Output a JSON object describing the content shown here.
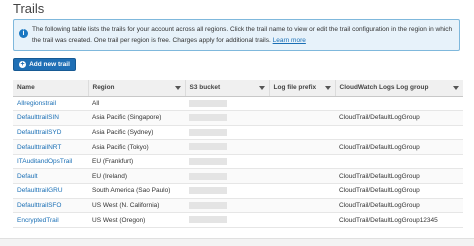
{
  "page": {
    "title": "Trails"
  },
  "info": {
    "text": "The following table lists the trails for your account across all regions. Click the trail name to view or edit the trail configuration in the region in which the trail was created. One trail per region is free. Charges apply for additional trails.",
    "link": "Learn more",
    "icon": "info-icon"
  },
  "toolbar": {
    "add_label": "Add new trail"
  },
  "table": {
    "headers": [
      "Name",
      "Region",
      "S3 bucket",
      "Log file prefix",
      "CloudWatch Logs Log group"
    ],
    "rows": [
      {
        "name": "Allregionstrail",
        "region": "All",
        "log_group": ""
      },
      {
        "name": "DefaulttrailSIN",
        "region": "Asia Pacific (Singapore)",
        "log_group": "CloudTrail/DefaultLogGroup"
      },
      {
        "name": "DefaulttrailSYD",
        "region": "Asia Pacific (Sydney)",
        "log_group": ""
      },
      {
        "name": "DefaulttrailNRT",
        "region": "Asia Pacific (Tokyo)",
        "log_group": "CloudTrail/DefaultLogGroup"
      },
      {
        "name": "ITAuditandOpsTrail",
        "region": "EU (Frankfurt)",
        "log_group": ""
      },
      {
        "name": "Default",
        "region": "EU (Ireland)",
        "log_group": "CloudTrail/DefaultLogGroup"
      },
      {
        "name": "DefaulttrailGRU",
        "region": "South America (Sao Paulo)",
        "log_group": "CloudTrail/DefaultLogGroup"
      },
      {
        "name": "DefaulttrailSFO",
        "region": "US West (N. California)",
        "log_group": "CloudTrail/DefaultLogGroup"
      },
      {
        "name": "EncryptedTrail",
        "region": "US West (Oregon)",
        "log_group": "CloudTrail/DefaultLogGroup12345"
      }
    ]
  }
}
